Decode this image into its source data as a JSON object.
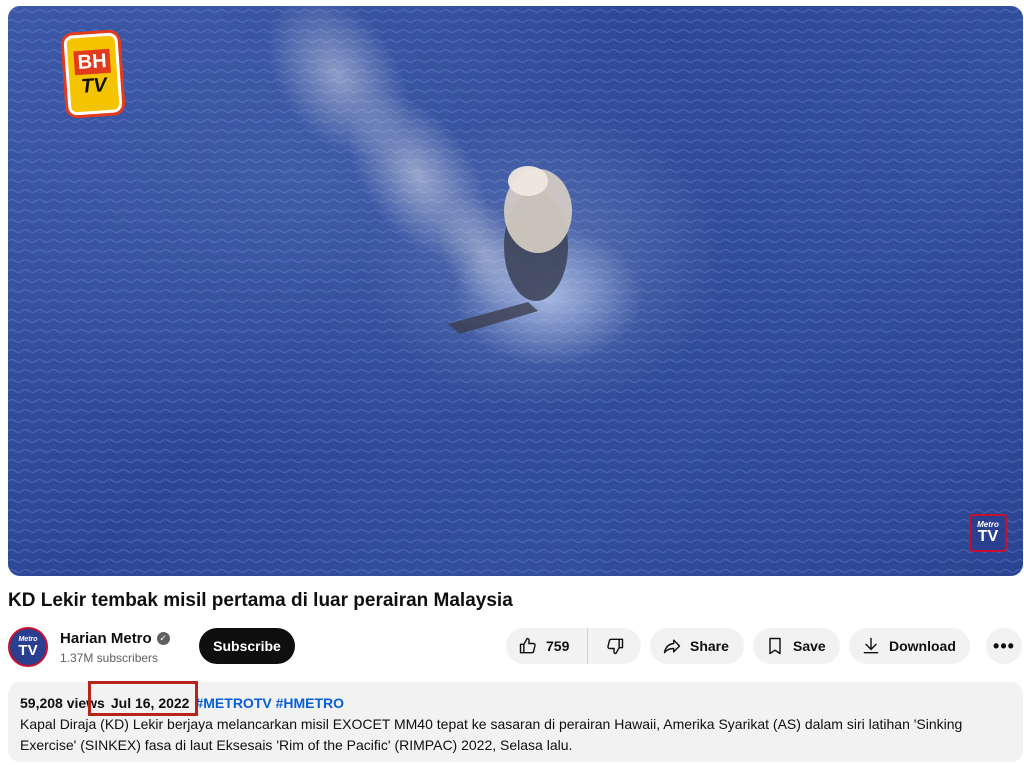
{
  "video": {
    "watermark_top_left": "BH TV",
    "watermark_bottom_right": "Metro TV",
    "title": "KD Lekir tembak misil pertama di luar perairan Malaysia"
  },
  "channel": {
    "name": "Harian Metro",
    "avatar_text_top": "Metro",
    "avatar_text_bottom": "TV",
    "subscribers": "1.37M subscribers",
    "verified": true
  },
  "actions": {
    "subscribe_label": "Subscribe",
    "like_count": "759",
    "share_label": "Share",
    "save_label": "Save",
    "download_label": "Download",
    "more_label": "•••"
  },
  "description": {
    "views": "59,208 views",
    "date": "Jul 16, 2022",
    "hashtags": "#METROTV #HMETRO",
    "text": "Kapal Diraja (KD) Lekir berjaya melancarkan misil EXOCET MM40 tepat ke sasaran di perairan Hawaii, Amerika Syarikat (AS) dalam siri latihan 'Sinking Exercise' (SINKEX) fasa di laut Eksesais 'Rim of the Pacific' (RIMPAC) 2022, Selasa lalu."
  },
  "colors": {
    "highlight_box": "#b8241c",
    "hashtag": "#065fd4",
    "ocean": "#2e4a98"
  },
  "icons": [
    "like-icon",
    "dislike-icon",
    "share-icon",
    "save-icon",
    "download-icon",
    "more-icon",
    "verified-icon"
  ]
}
